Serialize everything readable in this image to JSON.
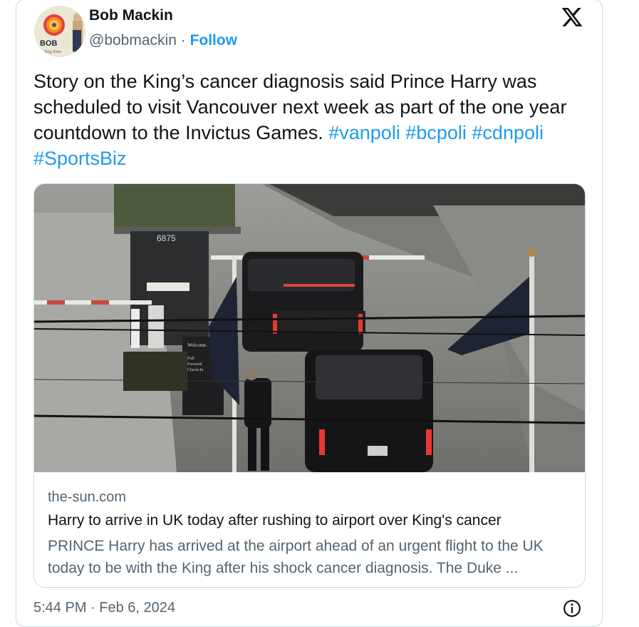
{
  "author": {
    "name": "Bob Mackin",
    "handle": "@bobmackin",
    "separator": "·",
    "follow_label": "Follow",
    "avatar_text": "BOB",
    "avatar_subtext": "Sing Zone"
  },
  "tweet": {
    "text": "Story on the King’s cancer diagnosis said Prince Harry was scheduled to visit Vancouver next week as part of the one year countdown to the Invictus Games.",
    "hashtags": [
      "#vanpoli",
      "#bcpoli",
      "#cdnpoli",
      "#SportsBiz"
    ]
  },
  "card": {
    "photo_sign_number": "6875",
    "photo_welcome_sign": [
      "Welcome.",
      "Pull",
      "Forward",
      "Check-In"
    ],
    "domain": "the-sun.com",
    "title": "Harry to arrive in UK today after rushing to airport over King's cancer",
    "description": "PRINCE Harry has arrived at the airport ahead of an urgent flight to the UK today to be with the King after his shock cancer diagnosis. The Duke ..."
  },
  "footer": {
    "time": "5:44 PM",
    "separator": "·",
    "date": "Feb 6, 2024"
  },
  "icons": {
    "brand": "x-logo-icon",
    "info": "info-icon"
  },
  "colors": {
    "link": "#1d9bf0",
    "text": "#0f1419",
    "muted": "#536471",
    "border": "#cfd9de"
  }
}
